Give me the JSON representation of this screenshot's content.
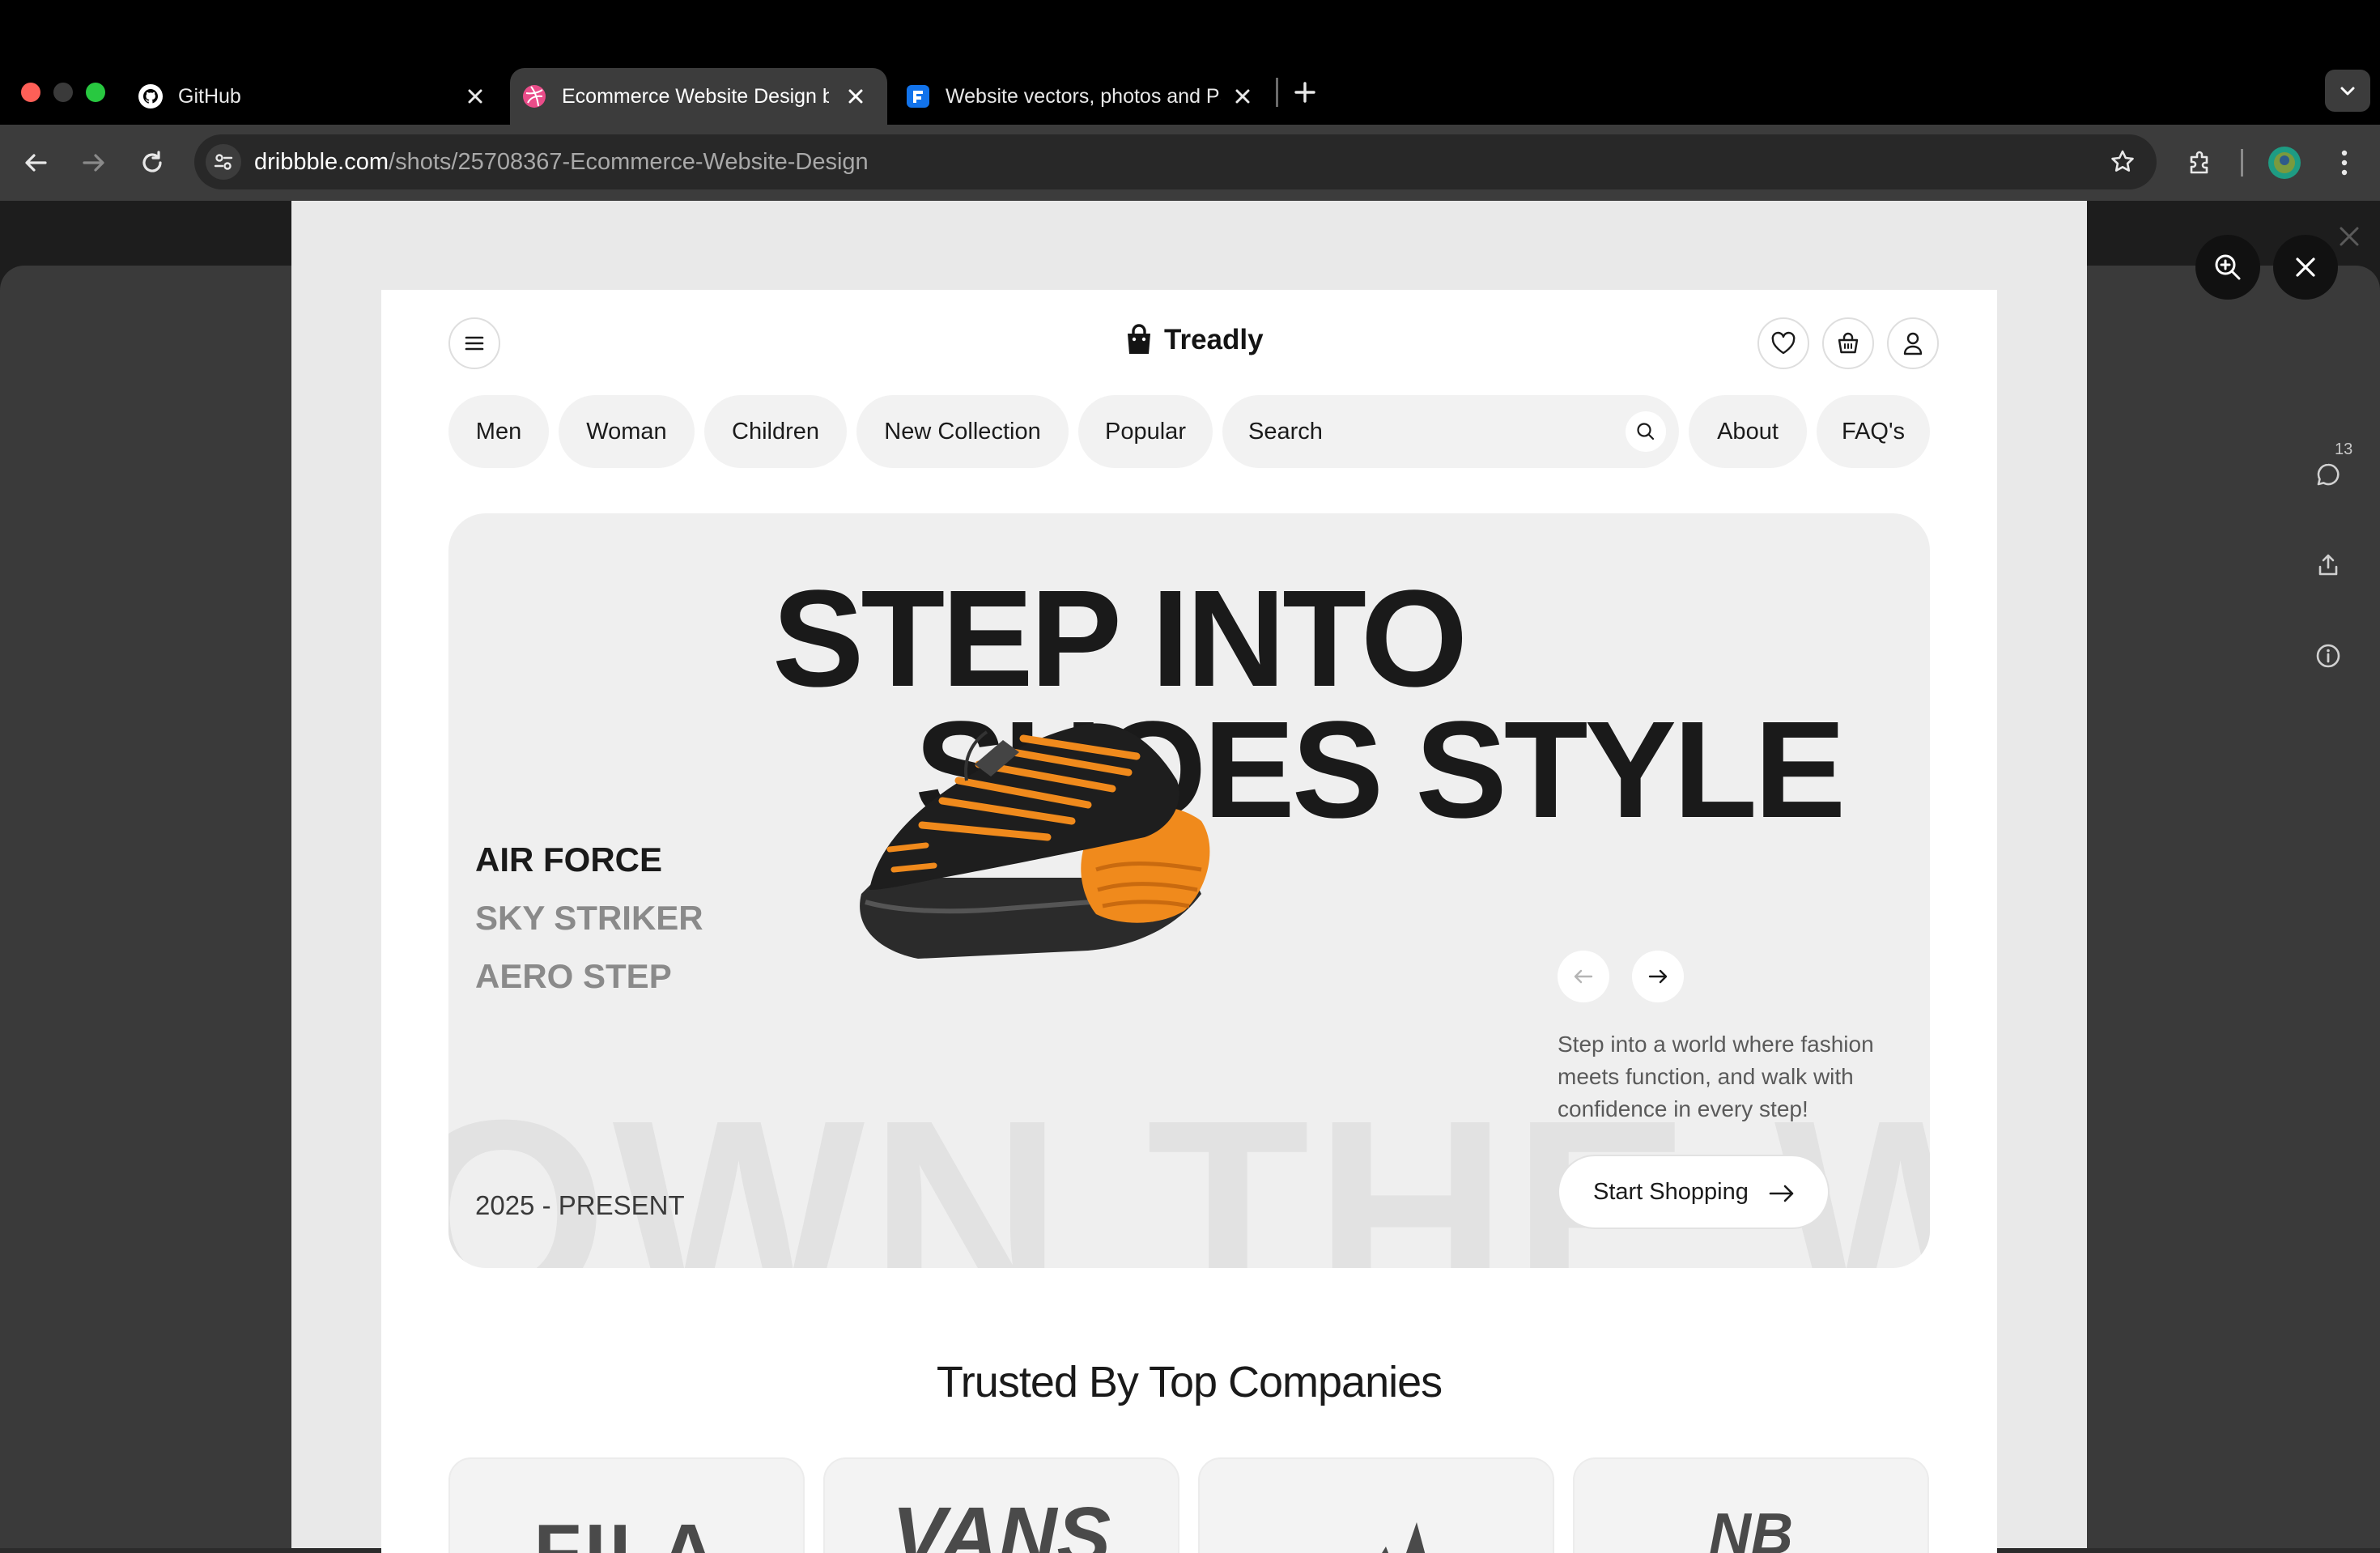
{
  "browser": {
    "tabs": [
      {
        "title": "GitHub",
        "favicon": "github-icon"
      },
      {
        "title": "Ecommerce Website Design by",
        "favicon": "dribbble-icon"
      },
      {
        "title": "Website vectors, photos and PSD",
        "favicon": "freepik-icon"
      }
    ],
    "url_host": "dribbble.com",
    "url_path": "/shots/25708367-Ecommerce-Website-Design",
    "comment_count": "13"
  },
  "site": {
    "brand": "Treadly",
    "nav": [
      "Men",
      "Woman",
      "Children",
      "New Collection",
      "Popular",
      "About",
      "FAQ's"
    ],
    "search_placeholder": "Search",
    "hero": {
      "line1": "STEP INTO",
      "line2": "SHOES STYLE",
      "background_text": "OWN THE WALK",
      "products": [
        {
          "name": "AIR FORCE",
          "active": true
        },
        {
          "name": "SKY STRIKER",
          "active": false
        },
        {
          "name": "AERO STEP",
          "active": false
        }
      ],
      "years": "2025 - PRESENT",
      "description": "Step into a world where fashion meets function, and walk with confidence in every step!",
      "cta": "Start Shopping"
    },
    "trusted_title": "Trusted By Top Companies",
    "companies": [
      "FILA",
      "VANS",
      "adidas",
      "NB"
    ]
  },
  "colors": {
    "accent_orange": "#f08a1c",
    "text_dark": "#1a1a1a",
    "tab_active": "#3c3c3c"
  }
}
